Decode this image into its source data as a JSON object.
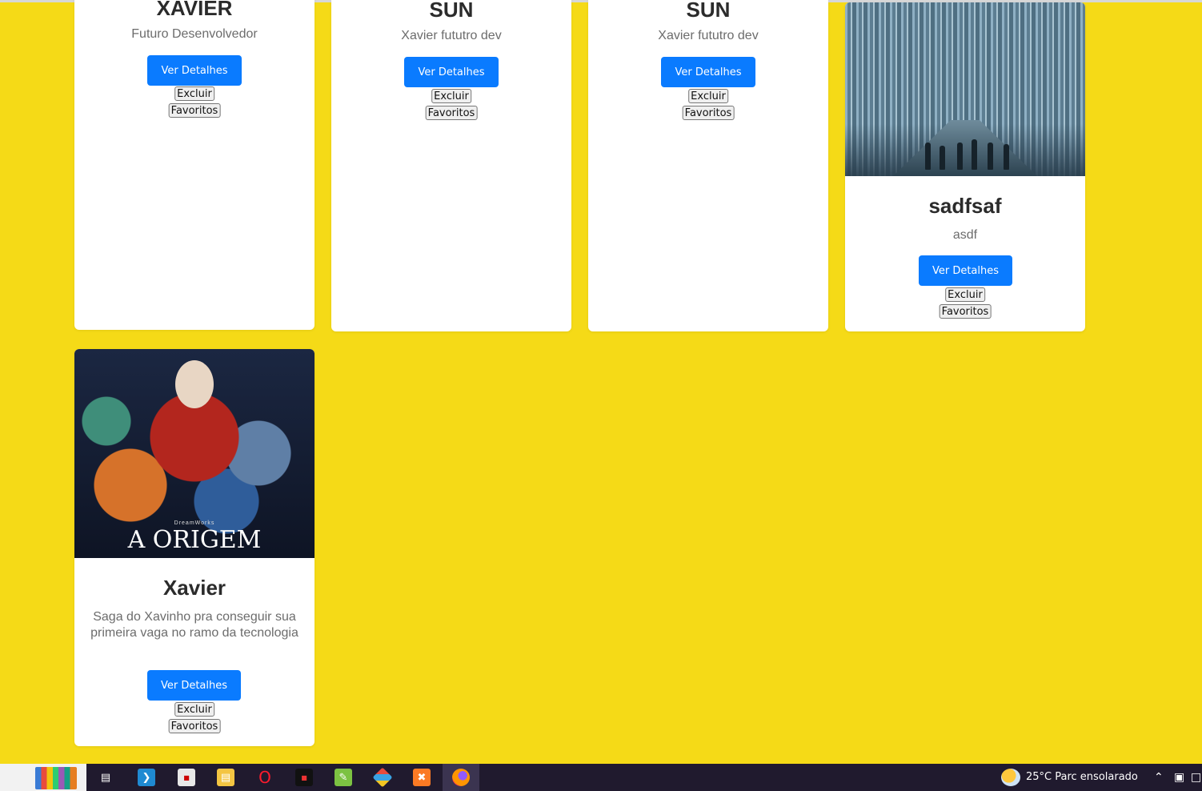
{
  "cards": [
    {
      "title": "XAVIER",
      "description": "Futuro Desenvolvedor",
      "details_label": "Ver Detalhes",
      "delete_label": "Excluir",
      "favorite_label": "Favoritos"
    },
    {
      "title": "SUN",
      "description": "Xavier fututro dev",
      "details_label": "Ver Detalhes",
      "delete_label": "Excluir",
      "favorite_label": "Favoritos"
    },
    {
      "title": "SUN",
      "description": "Xavier fututro dev",
      "details_label": "Ver Detalhes",
      "delete_label": "Excluir",
      "favorite_label": "Favoritos"
    },
    {
      "title": "sadfsaf",
      "description": "asdf",
      "details_label": "Ver Detalhes",
      "delete_label": "Excluir",
      "favorite_label": "Favoritos",
      "image": "city-street-poster"
    },
    {
      "title": "Xavier",
      "description": "Saga do Xavinho pra conseguir sua primeira vaga no ramo da tecnologia",
      "details_label": "Ver Detalhes",
      "delete_label": "Excluir",
      "favorite_label": "Favoritos",
      "image": "animated-movie-poster",
      "image_text": "A ORIGEM",
      "image_small_text": "DreamWorks"
    }
  ],
  "colors": {
    "background": "#f5da17",
    "primary": "#0a7bff",
    "card": "#ffffff"
  },
  "taskbar": {
    "weather": "25°C  Parc ensolarado",
    "icons": [
      "books-icon",
      "task-view-icon",
      "vscode-icon",
      "app-icon",
      "file-explorer-icon",
      "opera-icon",
      "app2-icon",
      "notepad-icon",
      "git-icon",
      "xampp-icon",
      "firefox-icon"
    ]
  }
}
